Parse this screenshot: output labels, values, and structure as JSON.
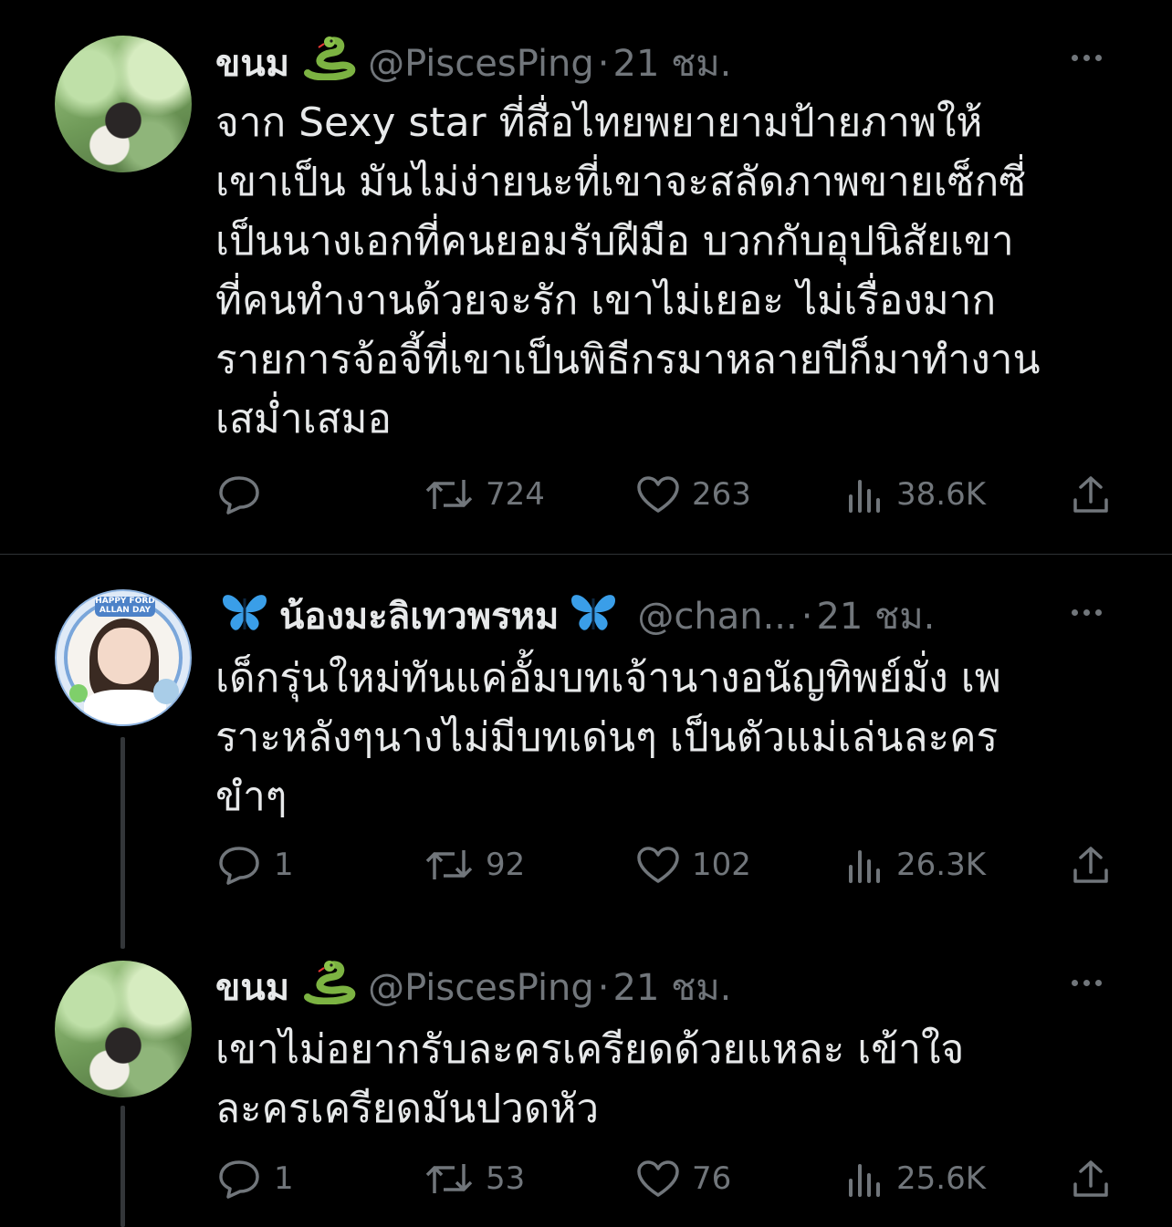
{
  "colors": {
    "background": "#000000",
    "text_primary": "#e7e9ea",
    "text_secondary": "#71767b",
    "divider": "#2f3336"
  },
  "tweets": [
    {
      "name": "ขนม",
      "name_emoji": "snake-emoji",
      "handle": "@PiscesPing",
      "separator": "·",
      "time": "21 ชม.",
      "lines": [
        "จาก Sexy star ที่สื่อไทยพยายามป้ายภาพให้",
        "เขาเป็น มันไม่ง่ายนะที่เขาจะสลัดภาพขายเซ็กซี่",
        "เป็นนางเอกที่คนยอมรับฝีมือ บวกกับอุปนิสัยเขา",
        "ที่คนทำงานด้วยจะรัก เขาไม่เยอะ ไม่เรื่องมาก",
        "รายการจ้อจี้ที่เขาเป็นพิธีกรมาหลายปีก็มาทำงาน",
        "เสม่ำเสมอ"
      ],
      "replies": "",
      "retweets": "724",
      "likes": "263",
      "views": "38.6K"
    },
    {
      "name": "น้องมะลิเทวพรหม",
      "name_emoji": "butterfly-emoji",
      "handle": "@chan...",
      "separator": "·",
      "time": "21 ชม.",
      "avatar_banner": "HAPPY FORD ALLAN DAY",
      "lines": [
        "เด็กรุ่นใหม่ทันแค่อั้มบทเจ้านางอนัญทิพย์มั่ง เพ",
        "ราะหลังๆนางไม่มีบทเด่นๆ เป็นตัวแม่เล่นละคร",
        "ขำๆ"
      ],
      "replies": "1",
      "retweets": "92",
      "likes": "102",
      "views": "26.3K"
    },
    {
      "name": "ขนม",
      "name_emoji": "snake-emoji",
      "handle": "@PiscesPing",
      "separator": "·",
      "time": "21 ชม.",
      "lines": [
        "เขาไม่อยากรับละครเครียดด้วยแหละ เข้าใจ",
        "ละครเครียดมันปวดหัว"
      ],
      "replies": "1",
      "retweets": "53",
      "likes": "76",
      "views": "25.6K"
    }
  ]
}
